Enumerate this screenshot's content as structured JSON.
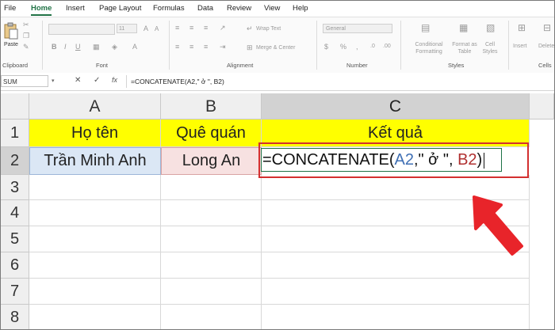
{
  "tabs": [
    "File",
    "Home",
    "Insert",
    "Page Layout",
    "Formulas",
    "Data",
    "Review",
    "View",
    "Help"
  ],
  "ribbon": {
    "clipboard_label": "Clipboard",
    "paste_label": "Paste",
    "font_label": "Font",
    "font_size": "11",
    "alignment_label": "Alignment",
    "wrap_text": "Wrap Text",
    "merge_center": "Merge & Center",
    "number_label": "Number",
    "number_format": "General",
    "conditional_formatting": "Conditional Formatting",
    "format_as_table": "Format as Table",
    "cell_styles": "Cell Styles",
    "styles_label": "Styles",
    "insert": "Insert",
    "delete": "Delete",
    "cells_label": "Cells"
  },
  "formula_bar": {
    "name_box": "SUM",
    "cancel_symbol": "✕",
    "enter_symbol": "✓",
    "fx_symbol": "fx",
    "formula": "=CONCATENATE(A2,\" ở \", B2)"
  },
  "grid": {
    "columns": [
      "A",
      "B",
      "C"
    ],
    "rows": [
      "1",
      "2",
      "3",
      "4",
      "5",
      "6",
      "7",
      "8"
    ],
    "headers": {
      "a1": "Họ tên",
      "b1": "Quê quán",
      "c1": "Kết quả"
    },
    "a2": "Trần Minh Anh",
    "b2": "Long An",
    "c2_prefix": "=CONCATENATE(",
    "c2_ref_a": "A2",
    "c2_middle": ",\" ở \", ",
    "c2_ref_b": "B2",
    "c2_suffix": ")"
  },
  "colors": {
    "accent": "#217346",
    "highlight": "#ffff00",
    "callout": "#d32f2f"
  }
}
